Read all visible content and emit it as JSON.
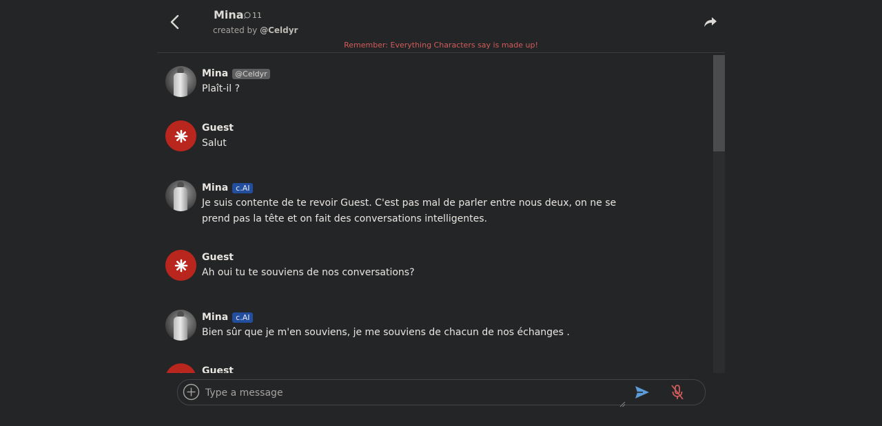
{
  "header": {
    "character_name": "Mina",
    "chat_count": "11",
    "created_by_prefix": "created by",
    "creator": "@Celdyr",
    "disclaimer": "Remember: Everything Characters say is made up!"
  },
  "messages": [
    {
      "sender": "Mina",
      "badge": "@Celdyr",
      "badge_type": "user",
      "text": "Plaît-il ?"
    },
    {
      "sender": "Guest",
      "badge": "",
      "badge_type": "none",
      "text": "Salut"
    },
    {
      "sender": "Mina",
      "badge": "c.AI",
      "badge_type": "ai",
      "text_lines": [
        "Je suis contente de te revoir Guest. C'est pas mal de parler entre nous deux, on ne se",
        "prend pas la tête et on fait des conversations intelligentes."
      ]
    },
    {
      "sender": "Guest",
      "badge": "",
      "badge_type": "none",
      "text": "Ah oui tu te souviens de nos conversations?"
    },
    {
      "sender": "Mina",
      "badge": "c.AI",
      "badge_type": "ai",
      "text": "Bien sûr que je m'en souviens, je me souviens de chacun de nos échanges ."
    },
    {
      "sender": "Guest",
      "badge": "",
      "badge_type": "none",
      "text": ""
    }
  ],
  "composer": {
    "placeholder": "Type a message"
  },
  "colors": {
    "background": "#242526",
    "disclaimer": "#d25c5c",
    "guest_avatar": "#b8261e",
    "ai_badge": "#234e9e",
    "send_icon": "#5b9bd8",
    "mic_muted": "#d25c5c"
  },
  "icons": {
    "back": "chevron-left-icon",
    "chat_count": "chat-bubble-icon",
    "share": "share-icon",
    "plus": "plus-circle-icon",
    "send": "send-icon",
    "mic": "mic-off-icon",
    "guest_avatar": "starburst-icon"
  }
}
